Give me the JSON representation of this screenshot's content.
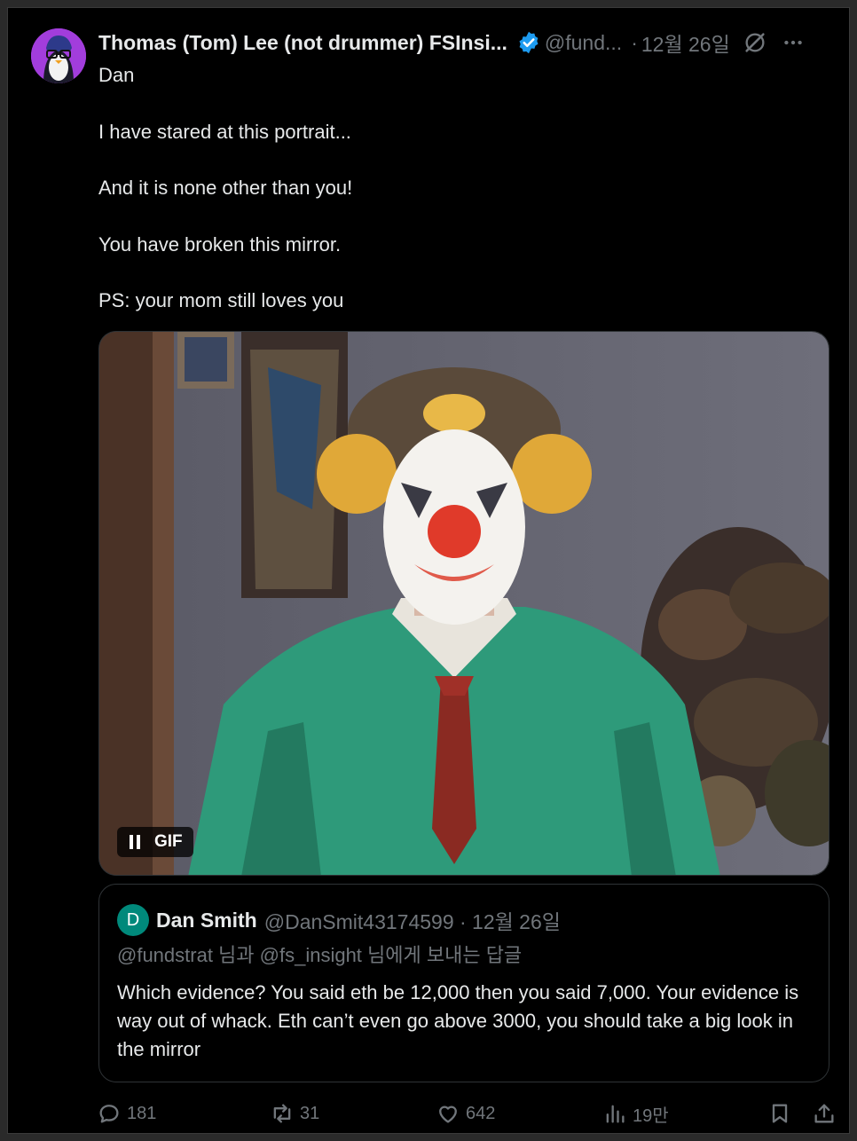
{
  "tweet": {
    "author_name": "Thomas (Tom) Lee (not drummer) FSInsi...",
    "handle": "@fund...",
    "separator": "·",
    "date": "12월 26일",
    "body": [
      "Dan",
      "I have stared at this portrait...",
      "And it is none other than you!",
      "You have broken this mirror.",
      "PS: your mom still loves you"
    ],
    "media": {
      "badge_label": "GIF"
    }
  },
  "quote": {
    "avatar_letter": "D",
    "name": "Dan Smith",
    "meta": "@DanSmit43174599 · 12월 26일",
    "reply_line": "@fundstrat 님과 @fs_insight 님에게 보내는 답글",
    "text": "Which evidence? You said eth be 12,000 then you said 7,000.  Your evidence is way out of whack. Eth can’t even go above 3000, you should take a big look in the mirror"
  },
  "actions": {
    "replies": "181",
    "reposts": "31",
    "likes": "642",
    "views": "19만"
  },
  "icons": {
    "verified": "verified-badge-icon",
    "grok": "grok-icon",
    "more": "more-icon",
    "pause": "pause-icon",
    "reply": "reply-icon",
    "repost": "repost-icon",
    "like": "heart-icon",
    "views": "views-icon",
    "bookmark": "bookmark-icon",
    "share": "share-icon"
  },
  "colors": {
    "background": "#000000",
    "text": "#e7e9ea",
    "muted": "#71767b",
    "verified": "#1d9bf0",
    "avatar_bg": "#a23ddc",
    "quote_avatar_bg": "#00897b"
  }
}
